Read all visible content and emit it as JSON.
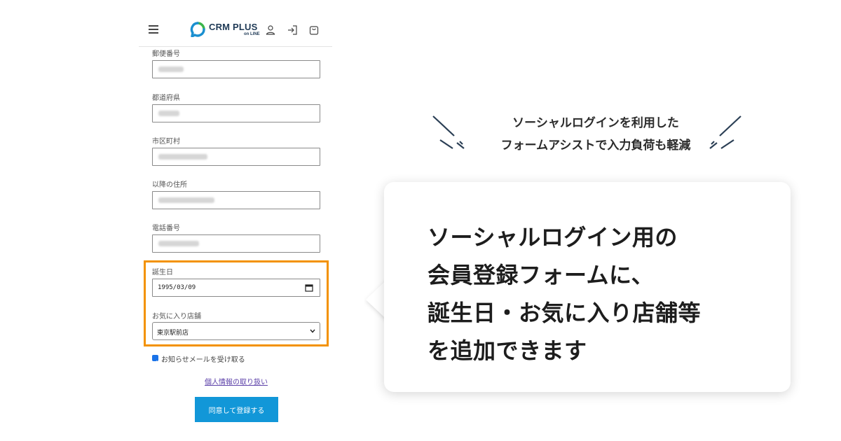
{
  "header": {
    "logo_text": "CRM PLUS",
    "logo_sub": "on LINE",
    "icons": [
      "menu-icon",
      "user-icon",
      "login-icon",
      "cart-icon"
    ]
  },
  "form": {
    "fields": [
      {
        "label": "郵便番号",
        "value": "(blurred)"
      },
      {
        "label": "都道府県",
        "value": "(blurred)"
      },
      {
        "label": "市区町村",
        "value": "(blurred)"
      },
      {
        "label": "以降の住所",
        "value": "(blurred)"
      },
      {
        "label": "電話番号",
        "value": "(blurred)"
      }
    ],
    "birthday": {
      "label": "誕生日",
      "value": "1995/03/09"
    },
    "favorite_store": {
      "label": "お気に入り店舗",
      "value": "東京駅前店"
    },
    "newsletter": {
      "label": "お知らせメールを受け取る",
      "checked": true
    },
    "privacy_link": "個人情報の取り扱い",
    "submit_label": "同意して登録する"
  },
  "promo": {
    "tagline_lines": [
      "ソーシャルログインを利用した",
      "フォームアシストで入力負荷も軽減"
    ],
    "headline_lines": [
      "ソーシャルログイン用の",
      "会員登録フォームに、",
      "誕生日・お気に入り店舗等",
      "を追加できます"
    ]
  },
  "colors": {
    "highlight": "#f39200",
    "button": "#1297d8",
    "logo_green": "#3bb54a",
    "logo_blue": "#1a8fd0",
    "link": "#5b3fa8"
  }
}
